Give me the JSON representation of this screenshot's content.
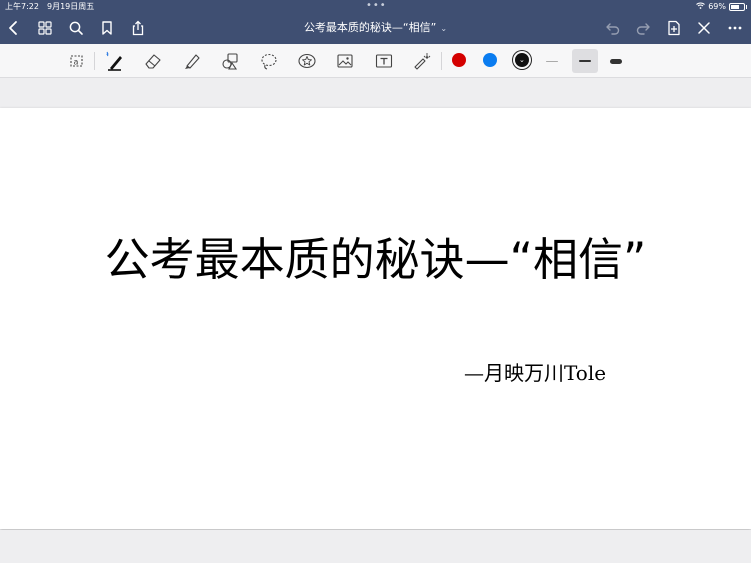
{
  "status_bar": {
    "time": "上午7:22",
    "date": "9月19日周五",
    "dots": "•••",
    "battery_text": "69%",
    "battery_level": 0.69
  },
  "nav": {
    "title": "公考最本质的秘诀—“相信”",
    "title_chevron": "⌄",
    "back_icon": "chevron-left-icon",
    "grid_icon": "grid-icon",
    "search_icon": "search-icon",
    "bookmark_icon": "bookmark-icon",
    "share_icon": "share-icon",
    "undo_icon": "undo-icon",
    "redo_icon": "redo-icon",
    "add_page_icon": "add-page-icon",
    "close_icon": "close-icon",
    "more_icon": "more-icon"
  },
  "toolbar": {
    "tools": [
      "text-select-icon",
      "pen-icon",
      "eraser-icon",
      "highlighter-icon",
      "shape-icon",
      "lasso-icon",
      "sticker-icon",
      "image-icon",
      "textbox-icon",
      "laser-pointer-icon"
    ],
    "colors": [
      "#d40000",
      "#0a7cf0",
      "#111111"
    ],
    "selected_color": "#111111",
    "stroke_widths": [
      "thin",
      "medium",
      "thick"
    ],
    "selected_stroke": "medium"
  },
  "page": {
    "title": "公考最本质的秘诀—“相信”",
    "subtitle": "—月映万川Tole"
  }
}
